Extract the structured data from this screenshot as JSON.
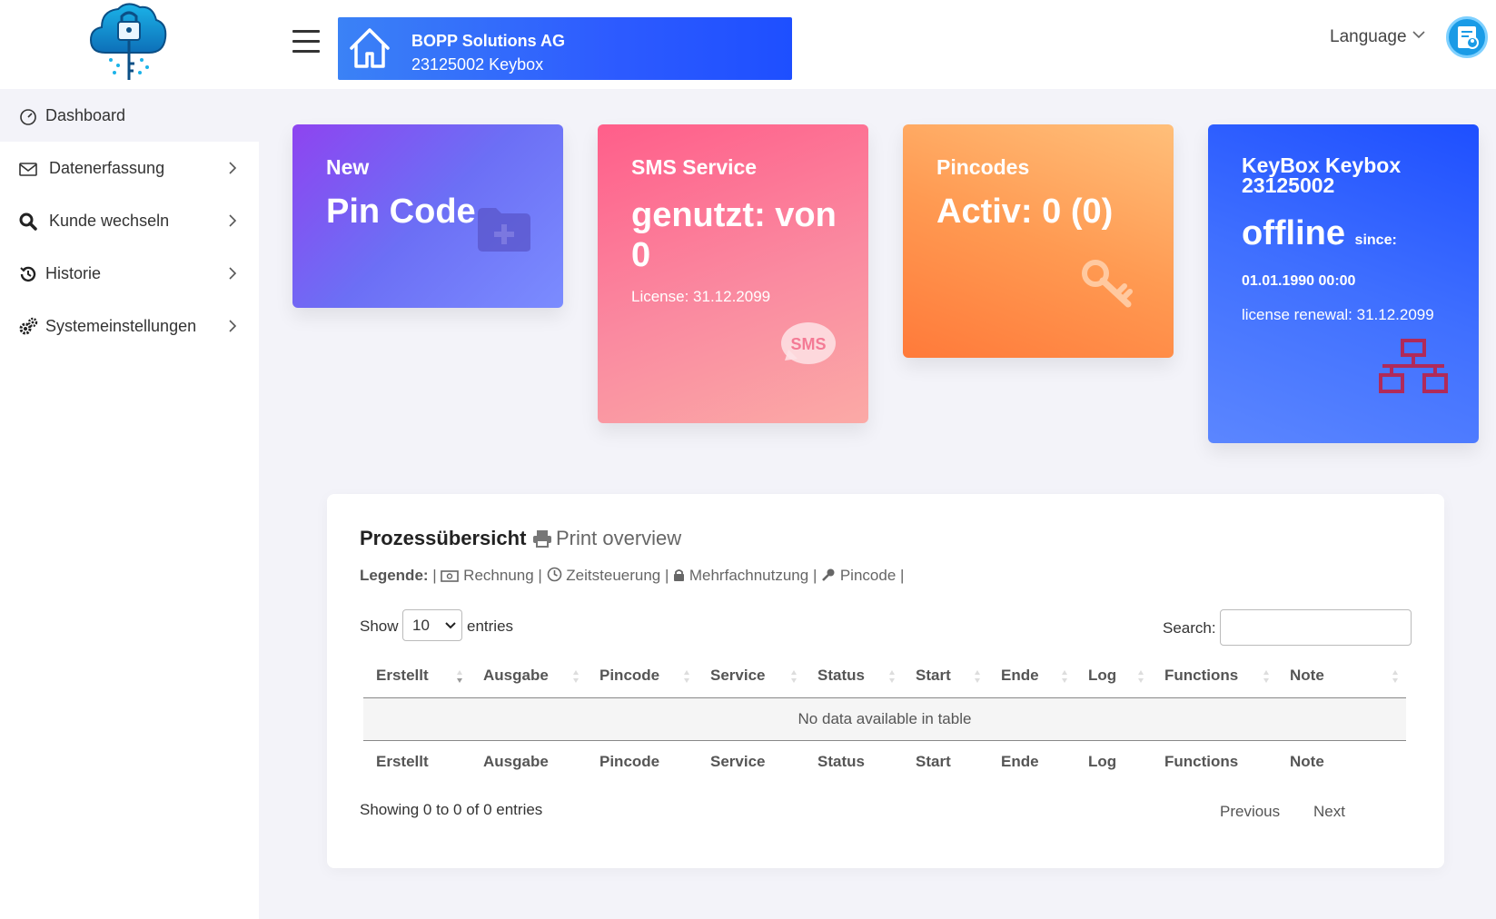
{
  "header": {
    "company_name": "BOPP Solutions AG",
    "keybox_label": "23125002 Keybox",
    "language_label": "Language"
  },
  "sidebar": {
    "items": [
      {
        "label": "Dashboard"
      },
      {
        "label": "Datenerfassung"
      },
      {
        "label": "Kunde wechseln"
      },
      {
        "label": "Historie"
      },
      {
        "label": "Systemeinstellungen"
      }
    ]
  },
  "cards": {
    "new_pin": {
      "title": "New",
      "value": "Pin Code",
      "color_start": "#8e44f0",
      "color_end": "#7b8cff"
    },
    "sms": {
      "title": "SMS Service",
      "value_line1": "genutzt: von",
      "value_line2": "0",
      "license": "License: 31.12.2099",
      "icon_text": "SMS",
      "color_start": "#ff5e8a",
      "color_end": "#fbaaa6"
    },
    "pincodes": {
      "title": "Pincodes",
      "value": "Activ: 0 (0)",
      "color_start": "#ffbf7a",
      "color_end": "#ff7a3a"
    },
    "keybox": {
      "title_line1": "KeyBox Keybox",
      "title_line2": "23125002",
      "status": "offline",
      "since_label": "since:",
      "since_value": "01.01.1990 00:00",
      "license_renewal": "license renewal: 31.12.2099",
      "color_start": "#1e4fff",
      "color_end": "#5b86ff"
    }
  },
  "panel": {
    "title": "Prozessübersicht",
    "print_label": "Print overview",
    "legend_label": "Legende:",
    "legend_items": [
      "Rechnung",
      "Zeitsteuerung",
      "Mehrfachnutzung",
      "Pincode"
    ],
    "show_label": "Show",
    "entries_value": "10",
    "entries_label": "entries",
    "search_label": "Search:",
    "search_value": "",
    "columns": [
      "Erstellt",
      "Ausgabe",
      "Pincode",
      "Service",
      "Status",
      "Start",
      "Ende",
      "Log",
      "Functions",
      "Note"
    ],
    "empty_message": "No data available in table",
    "info": "Showing 0 to 0 of 0 entries",
    "previous_label": "Previous",
    "next_label": "Next"
  }
}
